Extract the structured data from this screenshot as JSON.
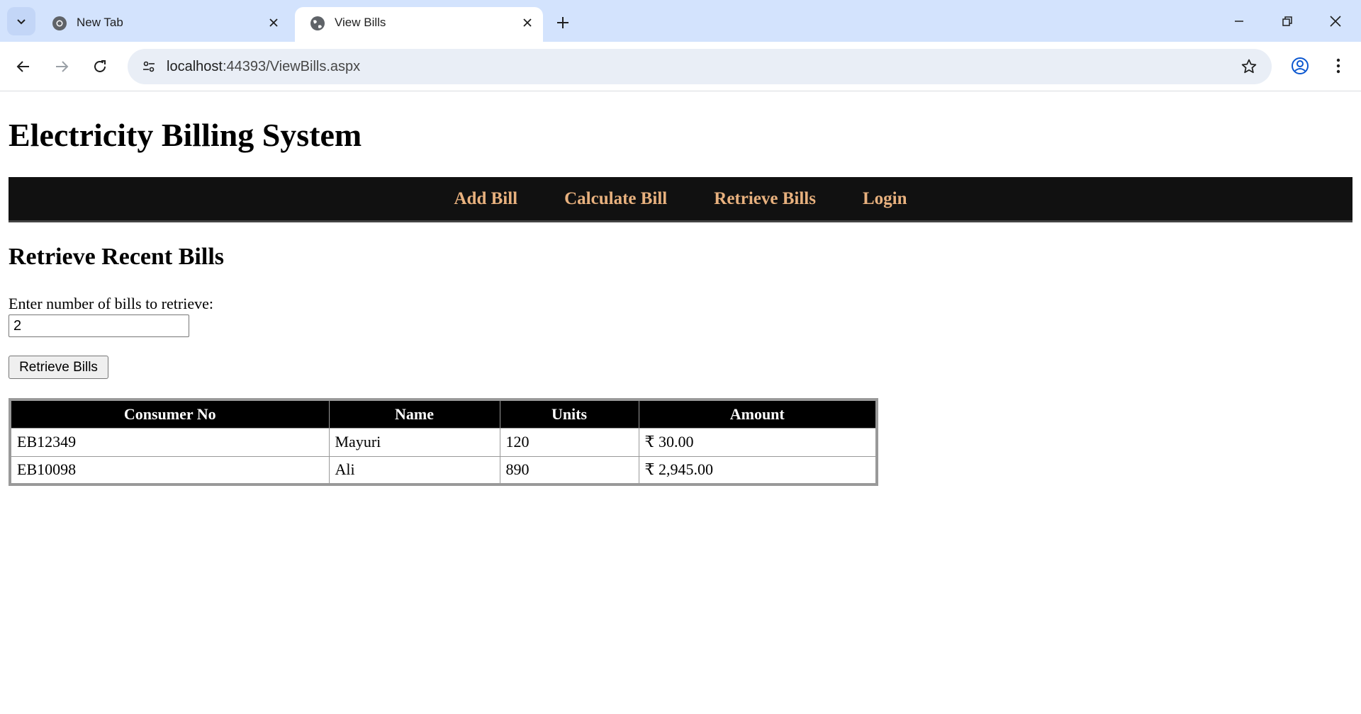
{
  "browser": {
    "tabs": [
      {
        "title": "New Tab",
        "icon": "chrome-icon",
        "active": false
      },
      {
        "title": "View Bills",
        "icon": "globe-icon",
        "active": true
      }
    ],
    "url_host": "localhost",
    "url_rest": ":44393/ViewBills.aspx"
  },
  "page": {
    "site_title": "Electricity Billing System",
    "nav": [
      "Add Bill",
      "Calculate Bill",
      "Retrieve Bills",
      "Login"
    ],
    "section_title": "Retrieve Recent Bills",
    "count_label": "Enter number of bills to retrieve:",
    "count_value": "2",
    "retrieve_button": "Retrieve Bills",
    "table": {
      "headers": [
        "Consumer No",
        "Name",
        "Units",
        "Amount"
      ],
      "rows": [
        [
          "EB12349",
          "Mayuri",
          "120",
          "₹ 30.00"
        ],
        [
          "EB10098",
          "Ali",
          "890",
          "₹ 2,945.00"
        ]
      ]
    }
  },
  "colors": {
    "nav_link": "#e8b17e",
    "nav_bg": "#111111",
    "tabstrip_bg": "#d3e3fd"
  }
}
